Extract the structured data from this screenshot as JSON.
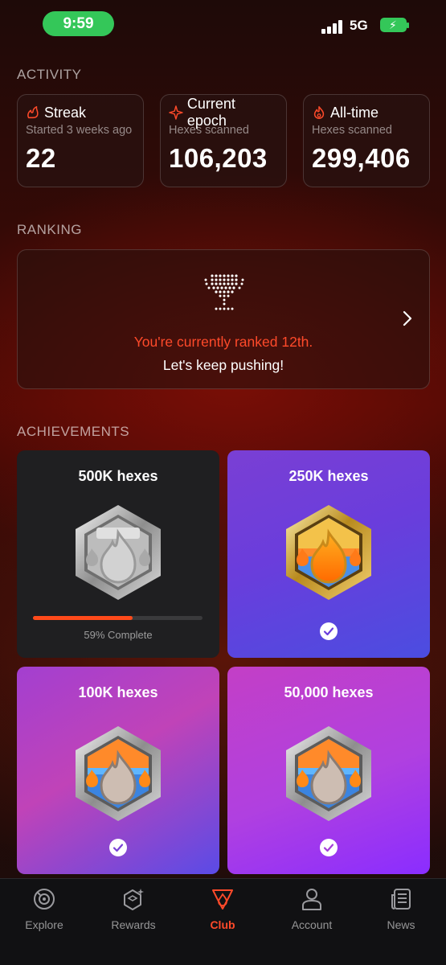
{
  "status_bar": {
    "time": "9:59",
    "network": "5G",
    "time_pill_color": "#34c759"
  },
  "activity": {
    "section_title": "ACTIVITY",
    "cards": [
      {
        "icon": "streak-flame-icon",
        "title": "Streak",
        "subtitle": "Started 3 weeks ago",
        "value": "22"
      },
      {
        "icon": "sparkle-icon",
        "title": "Current epoch",
        "subtitle": "Hexes scanned",
        "value": "106,203"
      },
      {
        "icon": "flame-icon",
        "title": "All-time",
        "subtitle": "Hexes scanned",
        "value": "299,406"
      }
    ]
  },
  "ranking": {
    "section_title": "RANKING",
    "icon": "trophy-icon",
    "rank_text": "You're currently ranked 12th.",
    "encouragement": "Let's keep pushing!",
    "accent_color": "#ff4a2a"
  },
  "achievements": {
    "section_title": "ACHIEVEMENTS",
    "items": [
      {
        "title": "500K hexes",
        "badge": "silver-hex-flame-badge",
        "progress": 0.59,
        "progress_label": "59% Complete",
        "completed": false
      },
      {
        "title": "250K hexes",
        "badge": "gold-hex-flame-badge",
        "completed": true
      },
      {
        "title": "100K hexes",
        "badge": "silver-hex-flame-badge",
        "completed": true
      },
      {
        "title": "50,000 hexes",
        "badge": "silver-hex-flame-badge",
        "completed": true
      }
    ]
  },
  "tab_bar": {
    "active": "Club",
    "tabs": [
      {
        "label": "Explore",
        "icon": "explore-icon"
      },
      {
        "label": "Rewards",
        "icon": "rewards-icon"
      },
      {
        "label": "Club",
        "icon": "club-icon"
      },
      {
        "label": "Account",
        "icon": "account-icon"
      },
      {
        "label": "News",
        "icon": "news-icon"
      }
    ]
  }
}
